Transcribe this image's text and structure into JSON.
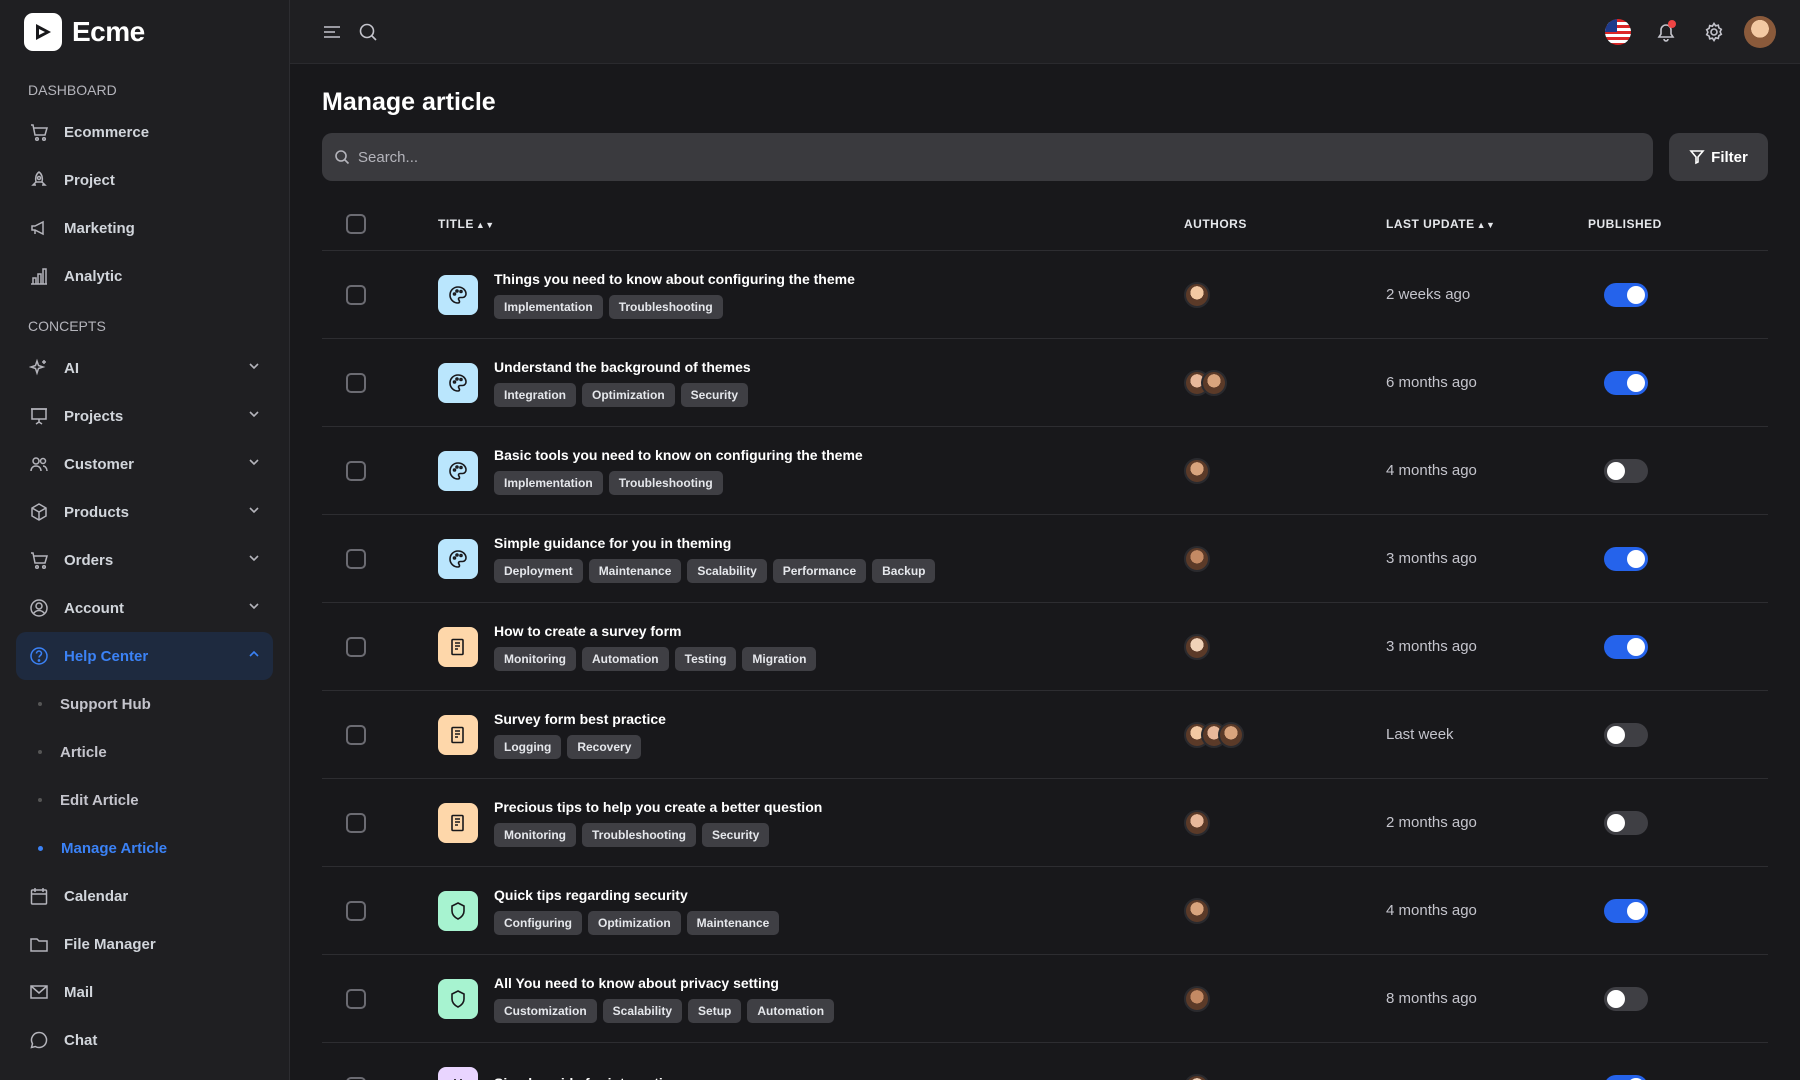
{
  "brand": {
    "name": "Ecme"
  },
  "sidebar": {
    "dashboard_title": "DASHBOARD",
    "dashboard_items": [
      {
        "label": "Ecommerce",
        "icon": "cart-icon"
      },
      {
        "label": "Project",
        "icon": "rocket-icon"
      },
      {
        "label": "Marketing",
        "icon": "megaphone-icon"
      },
      {
        "label": "Analytic",
        "icon": "bar-chart-icon"
      }
    ],
    "concepts_title": "CONCEPTS",
    "concept_items": [
      {
        "label": "AI",
        "icon": "sparkle-icon"
      },
      {
        "label": "Projects",
        "icon": "presentation-icon"
      },
      {
        "label": "Customer",
        "icon": "users-icon"
      },
      {
        "label": "Products",
        "icon": "box-icon"
      },
      {
        "label": "Orders",
        "icon": "cart-icon"
      },
      {
        "label": "Account",
        "icon": "user-circle-icon"
      }
    ],
    "help_center": {
      "label": "Help Center",
      "icon": "help-circle-icon"
    },
    "help_sub_items": [
      "Support Hub",
      "Article",
      "Edit Article",
      "Manage Article"
    ],
    "bottom_items": [
      {
        "label": "Calendar",
        "icon": "calendar-icon"
      },
      {
        "label": "File Manager",
        "icon": "folder-icon"
      },
      {
        "label": "Mail",
        "icon": "mail-icon"
      },
      {
        "label": "Chat",
        "icon": "chat-icon"
      }
    ]
  },
  "main": {
    "title": "Manage article",
    "search_placeholder": "Search...",
    "filter_label": "Filter",
    "columns": {
      "title": "TITLE",
      "authors": "AUTHORS",
      "last_update": "LAST UPDATE",
      "published": "PUBLISHED"
    }
  },
  "articles": [
    {
      "title": "Things you need to know about configuring the theme",
      "tags": [
        "Implementation",
        "Troubleshooting"
      ],
      "authors": 1,
      "updated": "2 weeks ago",
      "published": true,
      "icon_color": "#bae6fd",
      "icon": "palette-icon"
    },
    {
      "title": "Understand the background of themes",
      "tags": [
        "Integration",
        "Optimization",
        "Security"
      ],
      "authors": 2,
      "updated": "6 months ago",
      "published": true,
      "icon_color": "#bae6fd",
      "icon": "palette-icon"
    },
    {
      "title": "Basic tools you need to know on configuring the theme",
      "tags": [
        "Implementation",
        "Troubleshooting"
      ],
      "authors": 1,
      "updated": "4 months ago",
      "published": false,
      "icon_color": "#bae6fd",
      "icon": "palette-icon"
    },
    {
      "title": "Simple guidance for you in theming",
      "tags": [
        "Deployment",
        "Maintenance",
        "Scalability",
        "Performance",
        "Backup"
      ],
      "authors": 1,
      "updated": "3 months ago",
      "published": true,
      "icon_color": "#bae6fd",
      "icon": "palette-icon"
    },
    {
      "title": "How to create a survey form",
      "tags": [
        "Monitoring",
        "Automation",
        "Testing",
        "Migration"
      ],
      "authors": 1,
      "updated": "3 months ago",
      "published": true,
      "icon_color": "#fed7aa",
      "icon": "form-icon"
    },
    {
      "title": "Survey form best practice",
      "tags": [
        "Logging",
        "Recovery"
      ],
      "authors": 3,
      "updated": "Last week",
      "published": false,
      "icon_color": "#fed7aa",
      "icon": "form-icon"
    },
    {
      "title": "Precious tips to help you create a better question",
      "tags": [
        "Monitoring",
        "Troubleshooting",
        "Security"
      ],
      "authors": 1,
      "updated": "2 months ago",
      "published": false,
      "icon_color": "#fed7aa",
      "icon": "form-icon"
    },
    {
      "title": "Quick tips regarding security",
      "tags": [
        "Configuring",
        "Optimization",
        "Maintenance"
      ],
      "authors": 1,
      "updated": "4 months ago",
      "published": true,
      "icon_color": "#a7f3d0",
      "icon": "shield-icon"
    },
    {
      "title": "All You need to know about privacy setting",
      "tags": [
        "Customization",
        "Scalability",
        "Setup",
        "Automation"
      ],
      "authors": 1,
      "updated": "8 months ago",
      "published": false,
      "icon_color": "#a7f3d0",
      "icon": "shield-icon"
    },
    {
      "title": "Simple guide for integration",
      "tags": [],
      "authors": 1,
      "updated": "",
      "published": true,
      "icon_color": "#e9d5ff",
      "icon": "plug-icon"
    }
  ]
}
